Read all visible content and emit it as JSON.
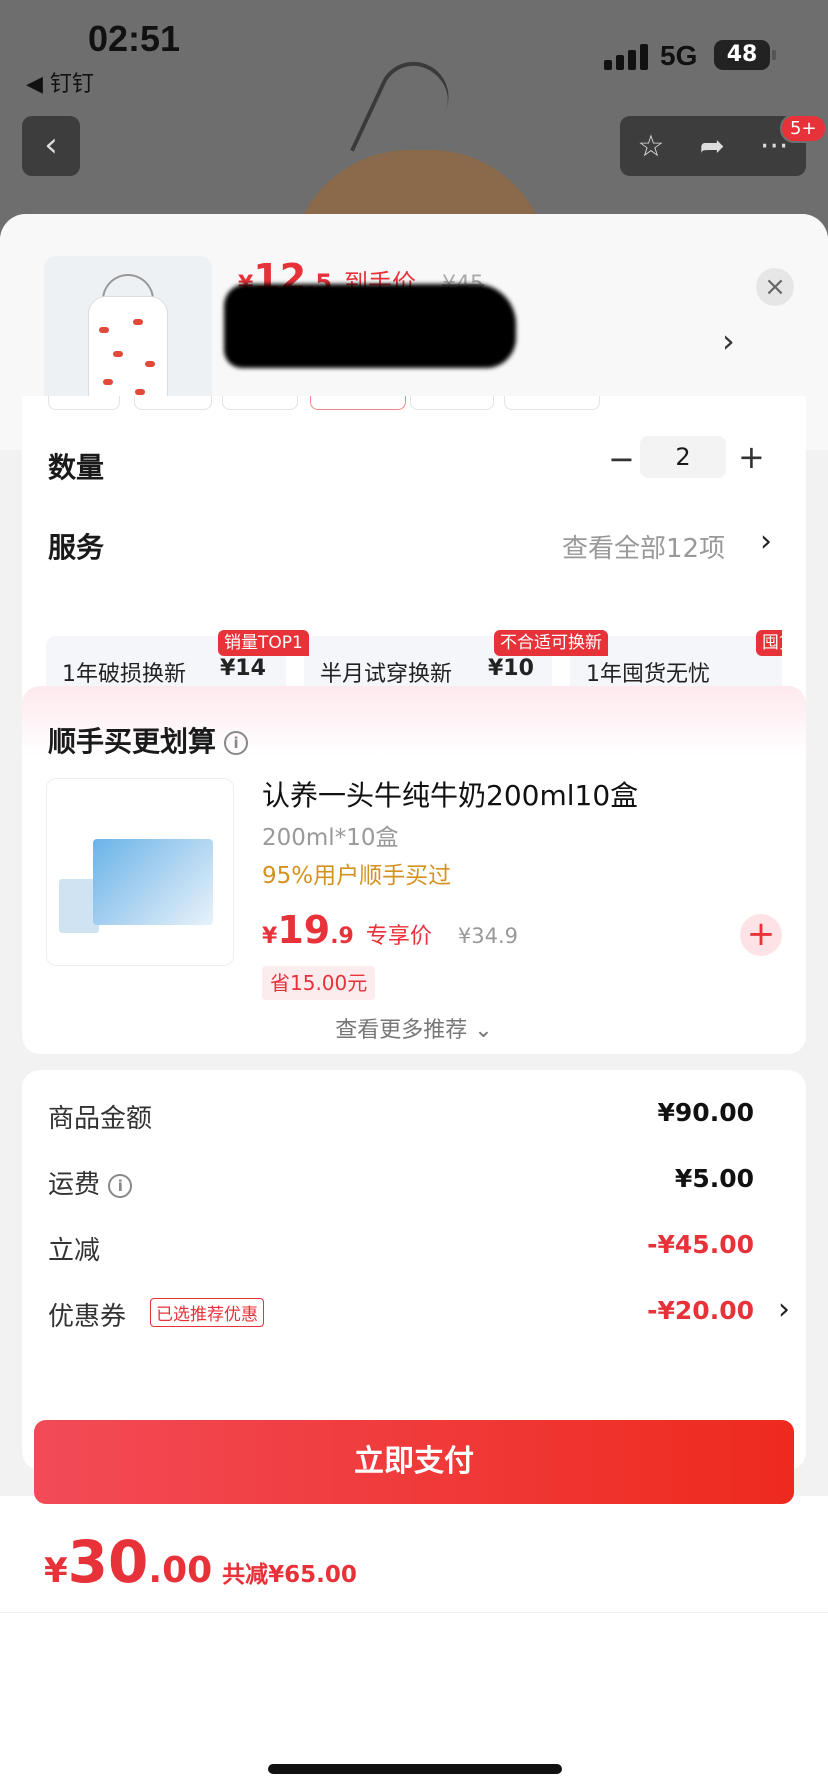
{
  "status": {
    "time": "02:51",
    "back_app": "◀ 钉钉",
    "network": "5G",
    "battery": "48"
  },
  "nav": {
    "back_icon": "‹",
    "badge": "5+"
  },
  "product": {
    "price_yen": "¥",
    "price_int": "12",
    "price_dec": ".5",
    "price_tag": "到手价",
    "orig_price": "¥45"
  },
  "quantity": {
    "label": "数量",
    "value": "2",
    "minus": "−",
    "plus": "+"
  },
  "service": {
    "label": "服务",
    "view_all": "查看全部12项",
    "items": [
      {
        "name": "1年破损换新",
        "price": "¥14",
        "badge": "销量TOP1"
      },
      {
        "name": "半月试穿换新",
        "price": "¥10",
        "badge": "不合适可换新"
      },
      {
        "name": "1年囤货无忧",
        "price": "",
        "badge": "囤货"
      }
    ]
  },
  "recommend": {
    "title": "顺手买更划算",
    "item_name": "认养一头牛纯牛奶200ml10盒",
    "spec": "200ml*10盒",
    "bought": "95%用户顺手买过",
    "price_yen": "¥",
    "price_int": "19",
    "price_dec": ".9",
    "price_tag": "专享价",
    "orig_price": "¥34.9",
    "save": "省15.00元",
    "add": "+",
    "more": "查看更多推荐 ⌄"
  },
  "summary": {
    "goods_label": "商品金额",
    "goods_value": "¥90.00",
    "shipping_label": "运费",
    "shipping_value": "¥5.00",
    "discount_label": "立减",
    "discount_value": "-¥45.00",
    "coupon_label": "优惠券",
    "coupon_tag": "已选推荐优惠",
    "coupon_value": "-¥20.00"
  },
  "total": {
    "yen": "¥",
    "int": "30",
    "dec": ".00",
    "save": "共减¥65.00"
  },
  "pay_button": "立即支付",
  "colors": {
    "accent": "#e8323a",
    "gold": "#d4921f"
  }
}
